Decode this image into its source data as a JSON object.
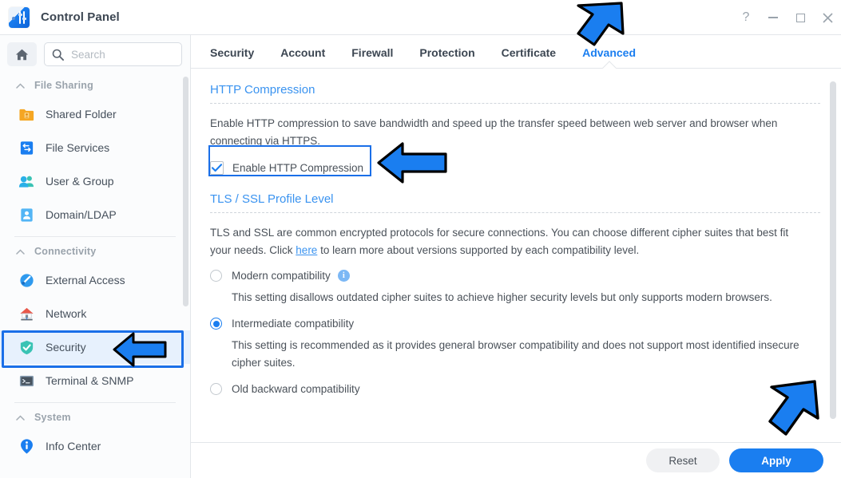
{
  "window": {
    "title": "Control Panel",
    "app_icon": "control-panel-icon",
    "controls": [
      {
        "name": "help-button",
        "glyph": "?"
      },
      {
        "name": "minimize-button",
        "glyph": "–"
      },
      {
        "name": "maximize-button",
        "glyph": "□"
      },
      {
        "name": "close-button",
        "glyph": "✕"
      }
    ]
  },
  "sidebar": {
    "home_icon": "home-icon",
    "search": {
      "placeholder": "Search",
      "value": "",
      "icon": "search-icon"
    },
    "groups": [
      {
        "label": "File Sharing",
        "items": [
          {
            "label": "Shared Folder",
            "icon": "shared-folder-icon",
            "selected": false
          },
          {
            "label": "File Services",
            "icon": "file-services-icon",
            "selected": false
          },
          {
            "label": "User & Group",
            "icon": "user-group-icon",
            "selected": false
          },
          {
            "label": "Domain/LDAP",
            "icon": "domain-ldap-icon",
            "selected": false
          }
        ]
      },
      {
        "label": "Connectivity",
        "items": [
          {
            "label": "External Access",
            "icon": "external-access-icon",
            "selected": false
          },
          {
            "label": "Network",
            "icon": "network-icon",
            "selected": false
          },
          {
            "label": "Security",
            "icon": "security-shield-icon",
            "selected": true
          },
          {
            "label": "Terminal & SNMP",
            "icon": "terminal-snmp-icon",
            "selected": false
          }
        ]
      },
      {
        "label": "System",
        "items": [
          {
            "label": "Info Center",
            "icon": "info-center-icon",
            "selected": false
          }
        ]
      }
    ]
  },
  "tabs": [
    {
      "label": "Security",
      "active": false
    },
    {
      "label": "Account",
      "active": false
    },
    {
      "label": "Firewall",
      "active": false
    },
    {
      "label": "Protection",
      "active": false
    },
    {
      "label": "Certificate",
      "active": false
    },
    {
      "label": "Advanced",
      "active": true
    }
  ],
  "sections": {
    "http_compression": {
      "title": "HTTP Compression",
      "description": "Enable HTTP compression to save bandwidth and speed up the transfer speed between web server and browser when connecting via HTTPS.",
      "checkbox": {
        "label": "Enable HTTP Compression",
        "checked": true
      }
    },
    "tls_ssl": {
      "title": "TLS / SSL Profile Level",
      "description_before_link": "TLS and SSL are common encrypted protocols for secure connections. You can choose different cipher suites that best fit your needs. Click ",
      "link_text": "here",
      "description_after_link": " to learn more about versions supported by each compatibility level.",
      "options": [
        {
          "label": "Modern compatibility",
          "selected": false,
          "has_info_icon": true,
          "info_glyph": "i",
          "description": "This setting disallows outdated cipher suites to achieve higher security levels but only supports modern browsers."
        },
        {
          "label": "Intermediate compatibility",
          "selected": true,
          "has_info_icon": false,
          "description": "This setting is recommended as it provides general browser compatibility and does not support most identified insecure cipher suites."
        },
        {
          "label": "Old backward compatibility",
          "selected": false,
          "has_info_icon": false,
          "description": ""
        }
      ]
    }
  },
  "footer": {
    "reset_label": "Reset",
    "apply_label": "Apply"
  },
  "annotations": {
    "accent_color": "#1a6fe8",
    "arrows": [
      {
        "name": "arrow-pointing-advanced-tab",
        "direction": "down-left"
      },
      {
        "name": "arrow-pointing-enable-http-compression-checkbox",
        "direction": "left"
      },
      {
        "name": "arrow-pointing-security-sidebar-item",
        "direction": "left"
      },
      {
        "name": "arrow-pointing-apply-button",
        "direction": "down-left"
      }
    ],
    "highlight_boxes": [
      {
        "name": "highlight-security-sidebar-item"
      },
      {
        "name": "highlight-enable-http-compression-checkbox"
      }
    ]
  }
}
